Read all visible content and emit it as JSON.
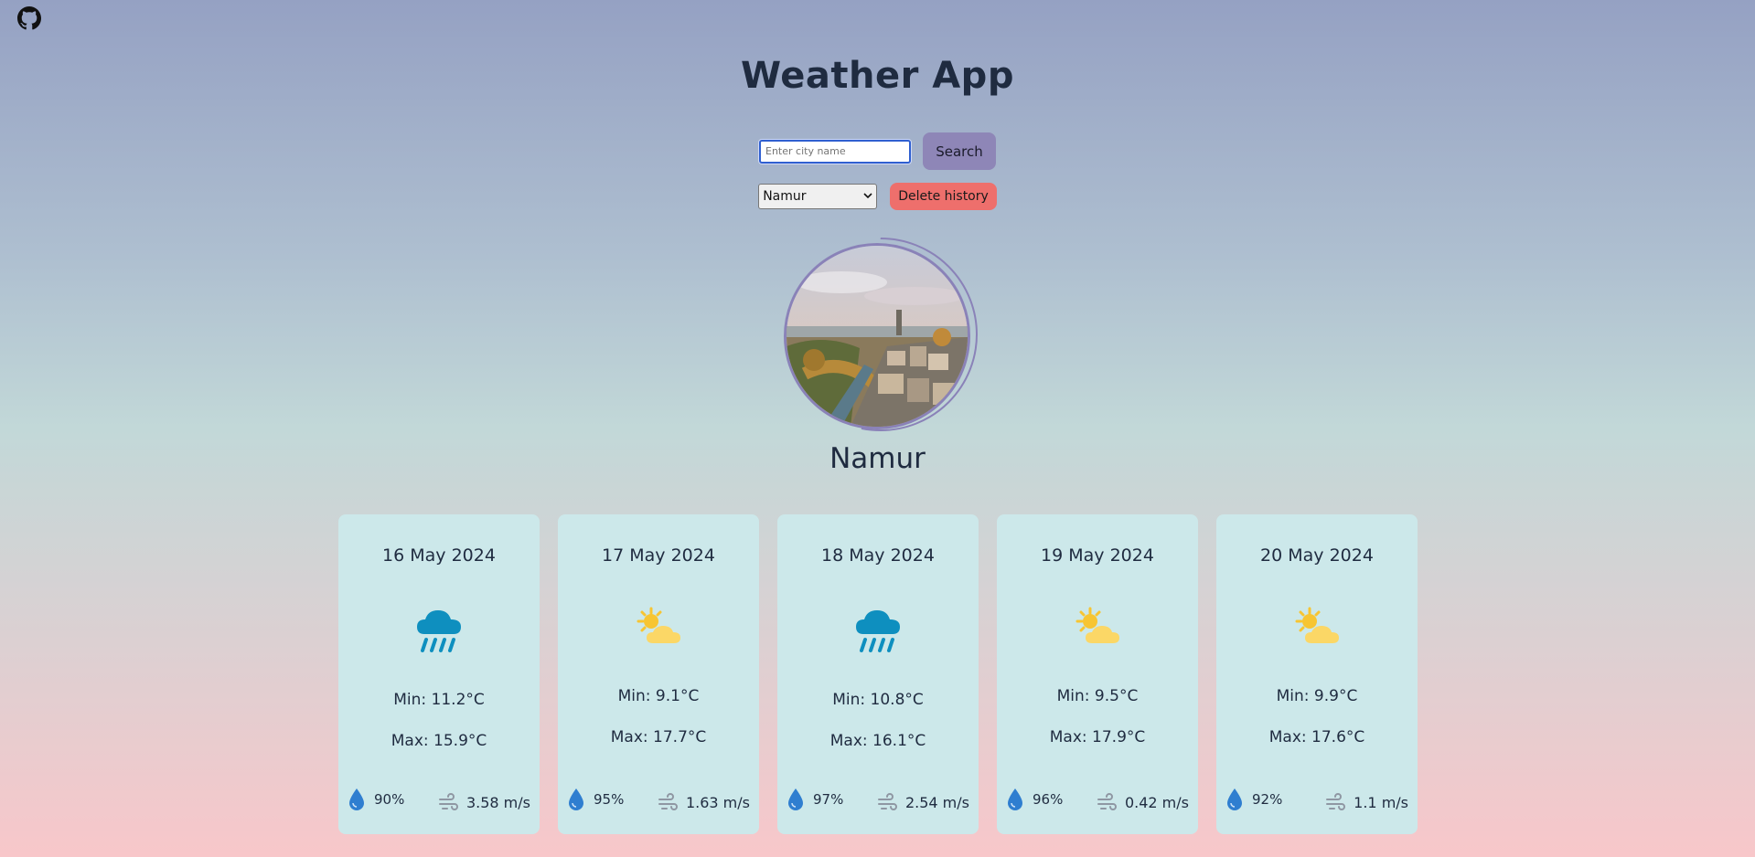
{
  "header": {
    "title": "Weather App",
    "github_icon": "github-icon"
  },
  "search": {
    "placeholder": "Enter city name",
    "value": "",
    "button_label": "Search"
  },
  "history": {
    "selected": "Namur",
    "delete_label": "Delete history"
  },
  "city": {
    "name": "Namur"
  },
  "colors": {
    "search_button": "#8e86b7",
    "delete_button": "#ee6f6c",
    "card_background": "#cce8ea",
    "rain_icon": "#0e8fbf",
    "sun_icon": "#f7c532",
    "drop_icon": "#2f7ed0"
  },
  "forecast": [
    {
      "date": "16 May 2024",
      "icon": "rain-cloud-icon",
      "min": "Min: 11.2°C",
      "max": "Max: 15.9°C",
      "humidity": "90%",
      "wind": "3.58 m/s"
    },
    {
      "date": "17 May 2024",
      "icon": "sun-behind-cloud-icon",
      "min": "Min: 9.1°C",
      "max": "Max: 17.7°C",
      "humidity": "95%",
      "wind": "1.63 m/s"
    },
    {
      "date": "18 May 2024",
      "icon": "rain-cloud-icon",
      "min": "Min: 10.8°C",
      "max": "Max: 16.1°C",
      "humidity": "97%",
      "wind": "2.54 m/s"
    },
    {
      "date": "19 May 2024",
      "icon": "sun-behind-cloud-icon",
      "min": "Min: 9.5°C",
      "max": "Max: 17.9°C",
      "humidity": "96%",
      "wind": "0.42 m/s"
    },
    {
      "date": "20 May 2024",
      "icon": "sun-behind-cloud-icon",
      "min": "Min: 9.9°C",
      "max": "Max: 17.6°C",
      "humidity": "92%",
      "wind": "1.1 m/s"
    }
  ]
}
